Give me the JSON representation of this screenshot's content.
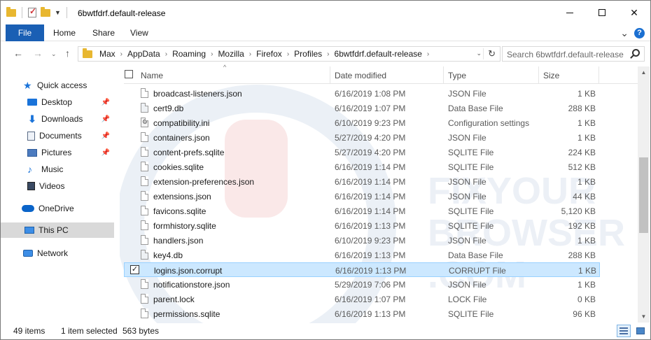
{
  "window": {
    "title": "6bwtfdrf.default-release"
  },
  "ribbon": {
    "tabs": [
      "File",
      "Home",
      "Share",
      "View"
    ]
  },
  "address": {
    "crumbs": [
      "Max",
      "AppData",
      "Roaming",
      "Mozilla",
      "Firefox",
      "Profiles",
      "6bwtfdrf.default-release"
    ],
    "search_placeholder": "Search 6bwtfdrf.default-release"
  },
  "sidebar": {
    "items": [
      {
        "label": "Quick access"
      },
      {
        "label": "Desktop"
      },
      {
        "label": "Downloads"
      },
      {
        "label": "Documents"
      },
      {
        "label": "Pictures"
      },
      {
        "label": "Music"
      },
      {
        "label": "Videos"
      },
      {
        "label": "OneDrive"
      },
      {
        "label": "This PC"
      },
      {
        "label": "Network"
      }
    ]
  },
  "columns": {
    "name": "Name",
    "date": "Date modified",
    "type": "Type",
    "size": "Size"
  },
  "files": [
    {
      "name": "broadcast-listeners.json",
      "date": "6/16/2019 1:08 PM",
      "type": "JSON File",
      "size": "1 KB"
    },
    {
      "name": "cert9.db",
      "date": "6/16/2019 1:07 PM",
      "type": "Data Base File",
      "size": "288 KB"
    },
    {
      "name": "compatibility.ini",
      "date": "6/10/2019 9:23 PM",
      "type": "Configuration settings",
      "size": "1 KB"
    },
    {
      "name": "containers.json",
      "date": "5/27/2019 4:20 PM",
      "type": "JSON File",
      "size": "1 KB"
    },
    {
      "name": "content-prefs.sqlite",
      "date": "5/27/2019 4:20 PM",
      "type": "SQLITE File",
      "size": "224 KB"
    },
    {
      "name": "cookies.sqlite",
      "date": "6/16/2019 1:14 PM",
      "type": "SQLITE File",
      "size": "512 KB"
    },
    {
      "name": "extension-preferences.json",
      "date": "6/16/2019 1:14 PM",
      "type": "JSON File",
      "size": "1 KB"
    },
    {
      "name": "extensions.json",
      "date": "6/16/2019 1:14 PM",
      "type": "JSON File",
      "size": "44 KB"
    },
    {
      "name": "favicons.sqlite",
      "date": "6/16/2019 1:14 PM",
      "type": "SQLITE File",
      "size": "5,120 KB"
    },
    {
      "name": "formhistory.sqlite",
      "date": "6/16/2019 1:13 PM",
      "type": "SQLITE File",
      "size": "192 KB"
    },
    {
      "name": "handlers.json",
      "date": "6/10/2019 9:23 PM",
      "type": "JSON File",
      "size": "1 KB"
    },
    {
      "name": "key4.db",
      "date": "6/16/2019 1:13 PM",
      "type": "Data Base File",
      "size": "288 KB"
    },
    {
      "name": "logins.json.corrupt",
      "date": "6/16/2019 1:13 PM",
      "type": "CORRUPT File",
      "size": "1 KB"
    },
    {
      "name": "notificationstore.json",
      "date": "5/29/2019 7:06 PM",
      "type": "JSON File",
      "size": "1 KB"
    },
    {
      "name": "parent.lock",
      "date": "6/16/2019 1:07 PM",
      "type": "LOCK File",
      "size": "0 KB"
    },
    {
      "name": "permissions.sqlite",
      "date": "6/16/2019 1:13 PM",
      "type": "SQLITE File",
      "size": "96 KB"
    }
  ],
  "status": {
    "items_count": "49 items",
    "selected": "1 item selected",
    "selected_size": "563 bytes"
  },
  "colors": {
    "file_tab": "#1a5fb4",
    "selection": "#cce8ff",
    "accent": "#1a73d9"
  }
}
